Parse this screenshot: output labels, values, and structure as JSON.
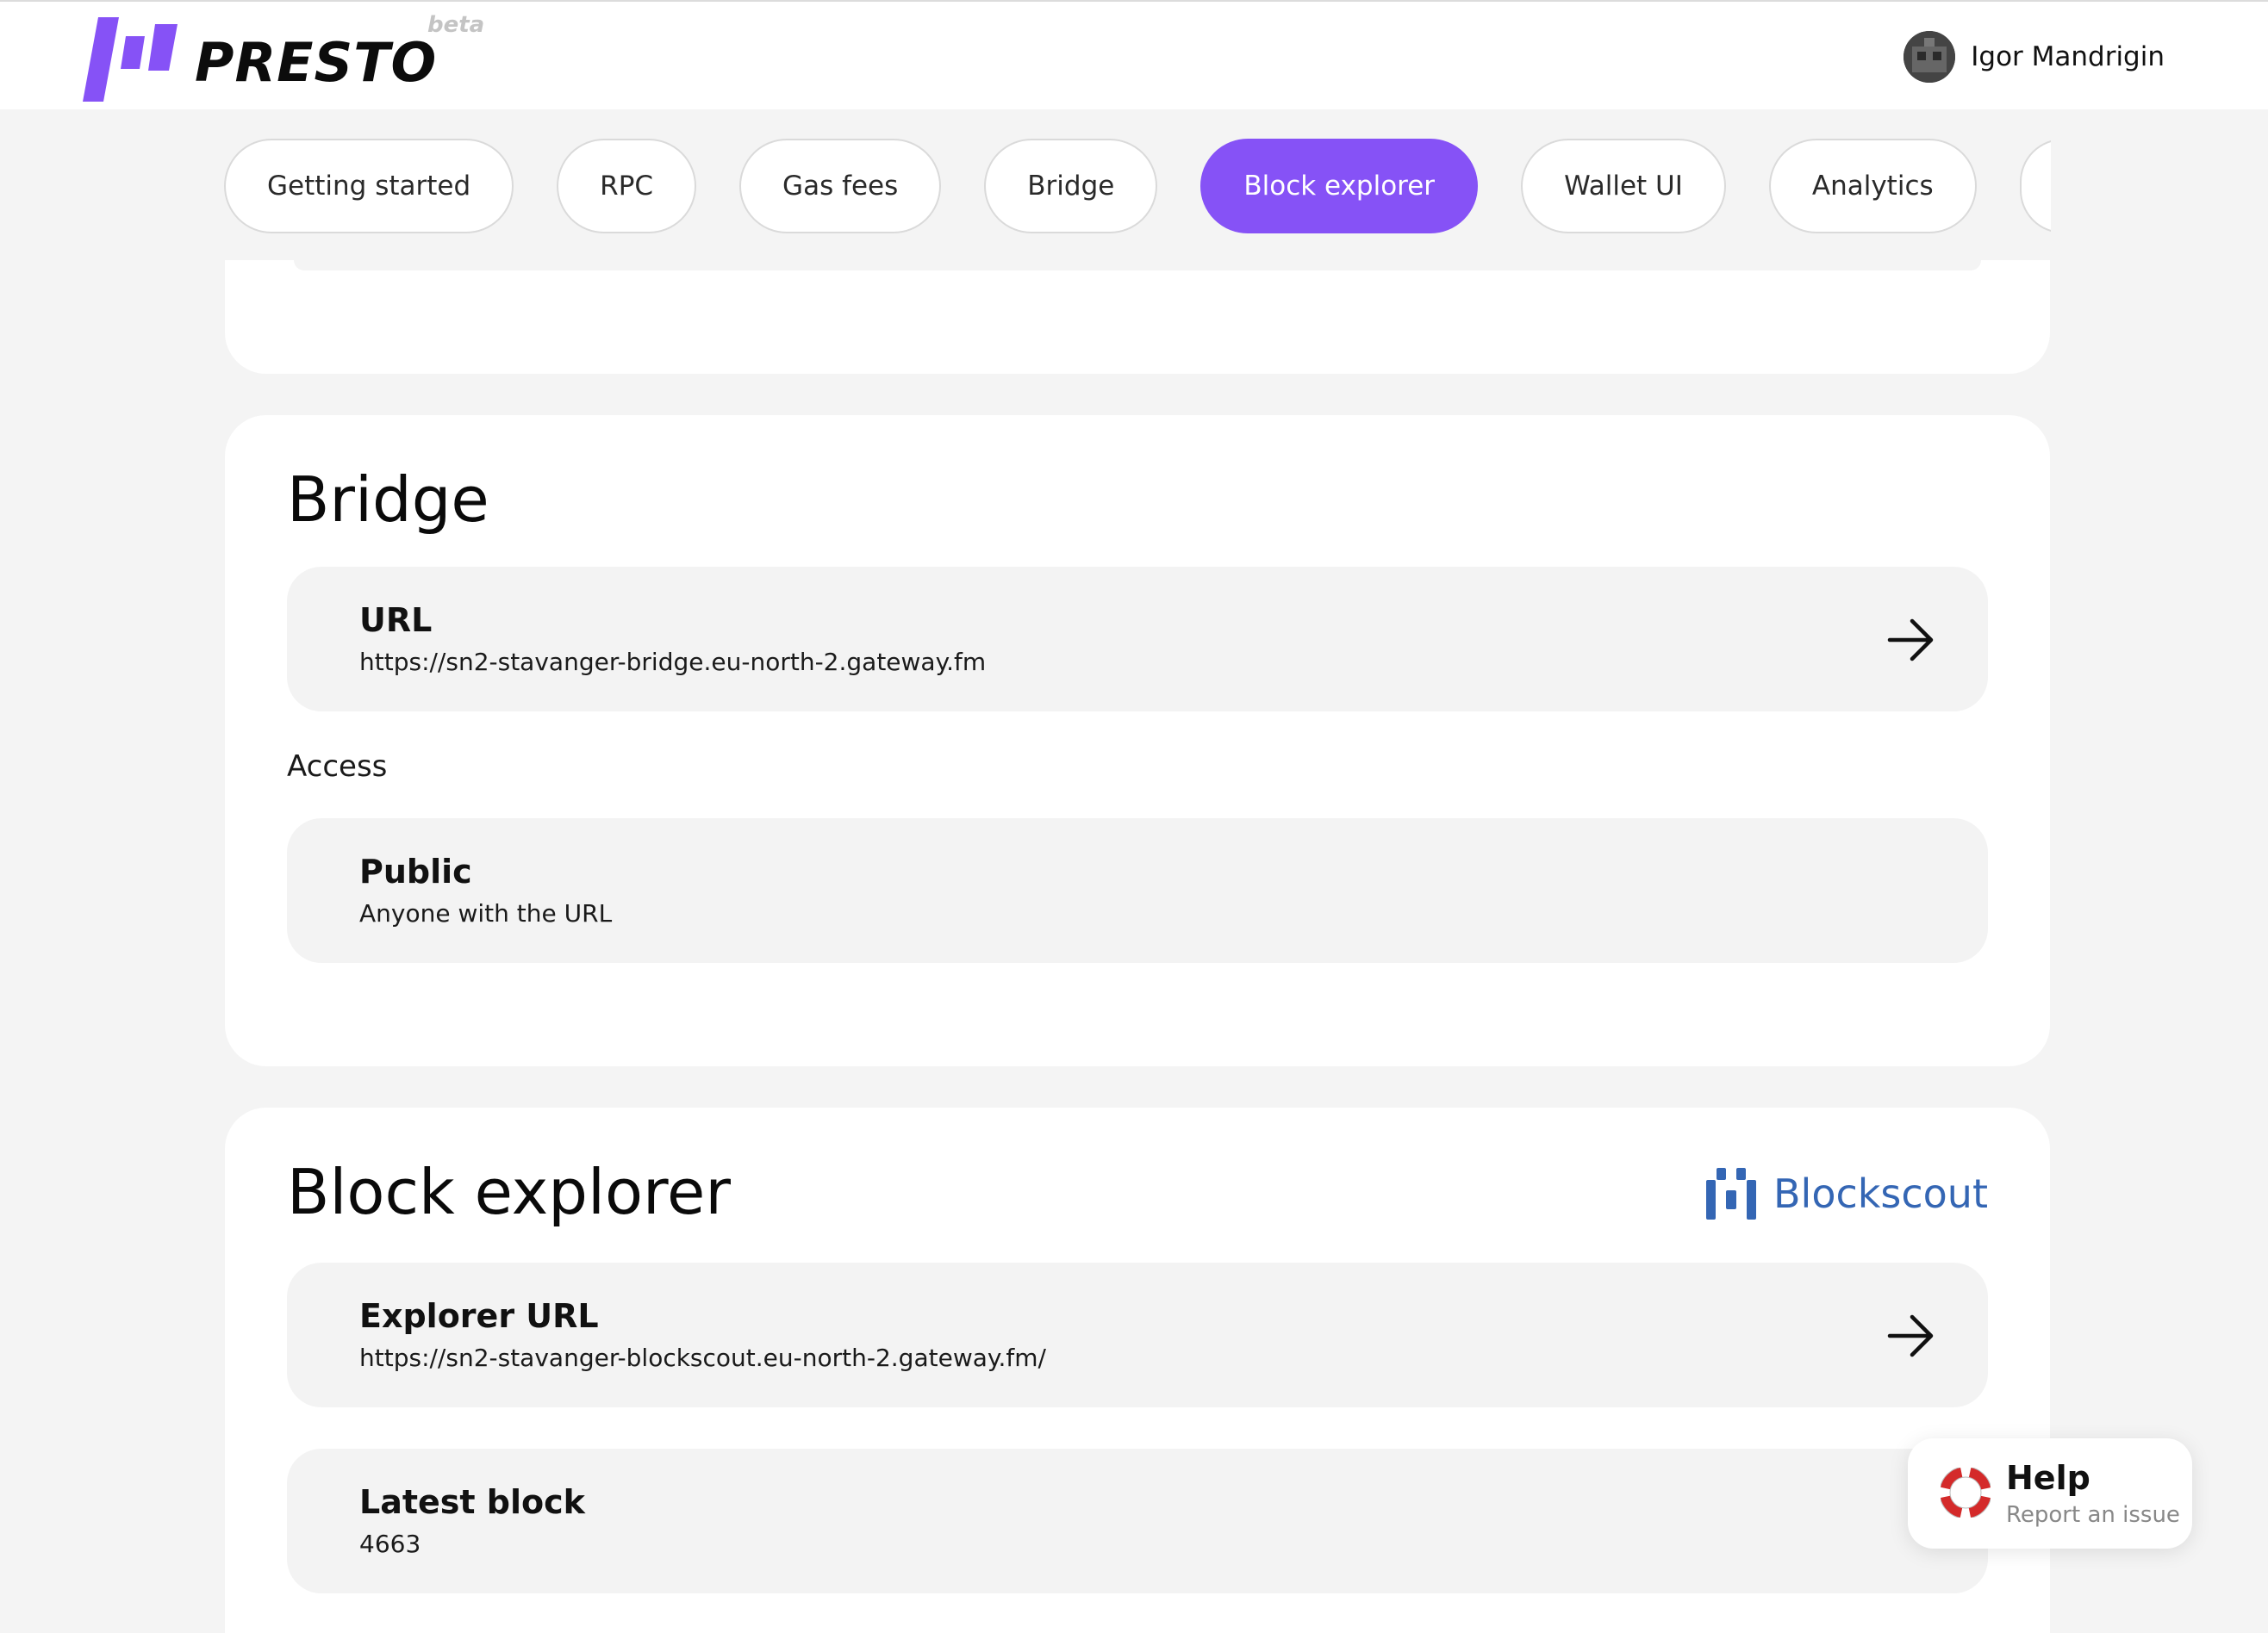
{
  "header": {
    "brand": "PRESTO",
    "badge": "beta",
    "user_name": "Igor Mandrigin",
    "brand_color": "#8652f6"
  },
  "tabs": [
    {
      "label": "Getting started",
      "active": false
    },
    {
      "label": "RPC",
      "active": false
    },
    {
      "label": "Gas fees",
      "active": false
    },
    {
      "label": "Bridge",
      "active": false
    },
    {
      "label": "Block explorer",
      "active": true
    },
    {
      "label": "Wallet UI",
      "active": false
    },
    {
      "label": "Analytics",
      "active": false
    },
    {
      "label": "",
      "active": false
    }
  ],
  "bridge": {
    "title": "Bridge",
    "url_title": "URL",
    "url_value": "https://sn2-stavanger-bridge.eu-north-2.gateway.fm",
    "access_label": "Access",
    "access_title": "Public",
    "access_sub": "Anyone with the URL"
  },
  "explorer": {
    "title": "Block explorer",
    "provider": "Blockscout",
    "provider_color": "#3466b4",
    "url_title": "Explorer URL",
    "url_value": "https://sn2-stavanger-blockscout.eu-north-2.gateway.fm/",
    "latest_title": "Latest block",
    "latest_value": "4663"
  },
  "help": {
    "title": "Help",
    "subtitle": "Report an issue"
  }
}
